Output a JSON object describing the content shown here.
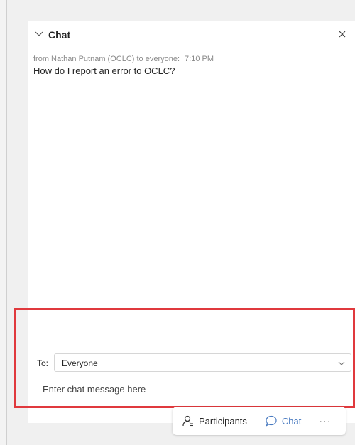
{
  "panel": {
    "title": "Chat",
    "collapse_icon": "chevron-down-icon",
    "close_icon": "close-icon"
  },
  "messages": [
    {
      "meta": "from Nathan Putnam (OCLC) to everyone:",
      "time": "7:10 PM",
      "text": "How do I report an error to OCLC?"
    }
  ],
  "compose": {
    "to_label": "To:",
    "recipient": "Everyone",
    "placeholder": "Enter chat message here"
  },
  "toolbar": {
    "participants_label": "Participants",
    "chat_label": "Chat",
    "more_label": "···"
  },
  "colors": {
    "accent": "#4a7bc1",
    "highlight": "#e0393d"
  }
}
